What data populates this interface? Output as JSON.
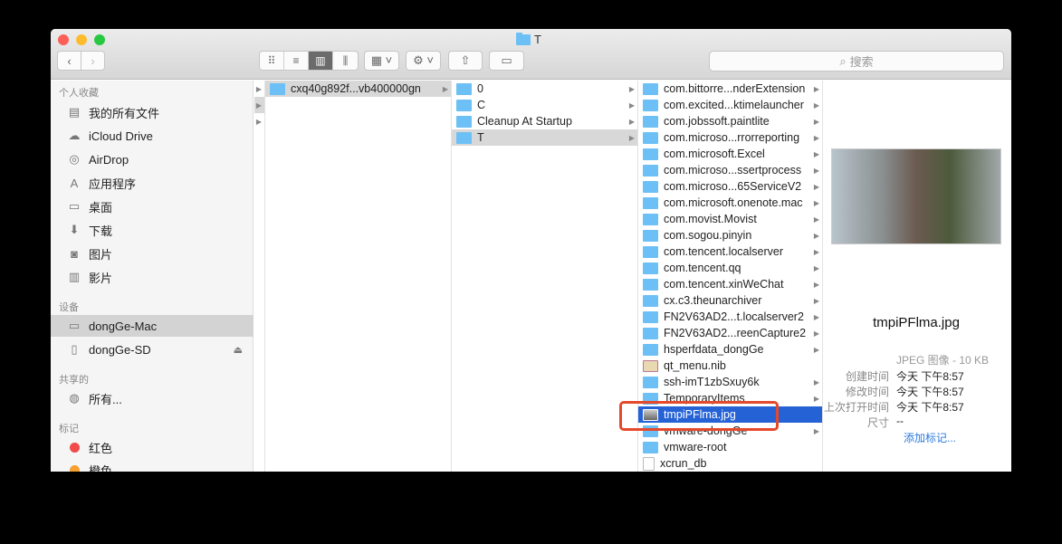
{
  "window": {
    "title": "T"
  },
  "toolbar": {
    "back": "‹",
    "forward": "›",
    "views": [
      "icon-view",
      "list-view",
      "column-view",
      "cover-flow-view"
    ],
    "search_placeholder": "搜索"
  },
  "sidebar": {
    "favorites_header": "个人收藏",
    "favorites": [
      {
        "label": "我的所有文件",
        "icon": "all-files-icon"
      },
      {
        "label": "iCloud Drive",
        "icon": "cloud-icon"
      },
      {
        "label": "AirDrop",
        "icon": "airdrop-icon"
      },
      {
        "label": "应用程序",
        "icon": "applications-icon"
      },
      {
        "label": "桌面",
        "icon": "desktop-icon"
      },
      {
        "label": "下载",
        "icon": "download-icon"
      },
      {
        "label": "图片",
        "icon": "camera-icon"
      },
      {
        "label": "影片",
        "icon": "film-icon"
      }
    ],
    "devices_header": "设备",
    "devices": [
      {
        "label": "dongGe-Mac",
        "selected": true
      },
      {
        "label": "dongGe-SD",
        "eject": "⏏"
      }
    ],
    "shared_header": "共享的",
    "shared": [
      {
        "label": "所有..."
      }
    ],
    "tags_header": "标记",
    "tags": [
      {
        "label": "红色",
        "color": "#f04a4a"
      },
      {
        "label": "橙色",
        "color": "#f5a030"
      }
    ]
  },
  "columns": {
    "col1": [
      {
        "name": "cxq40g892f...vb400000gn",
        "folder": true
      }
    ],
    "col2": [
      {
        "name": "0"
      },
      {
        "name": "C"
      },
      {
        "name": "Cleanup At Startup"
      },
      {
        "name": "T",
        "selected": true
      }
    ],
    "col3": [
      {
        "name": "com.bittorre...nderExtension",
        "type": "folder"
      },
      {
        "name": "com.excited...ktimelauncher",
        "type": "folder"
      },
      {
        "name": "com.jobssoft.paintlite",
        "type": "folder"
      },
      {
        "name": "com.microso...rrorreporting",
        "type": "folder"
      },
      {
        "name": "com.microsoft.Excel",
        "type": "folder"
      },
      {
        "name": "com.microso...ssertprocess",
        "type": "folder"
      },
      {
        "name": "com.microso...65ServiceV2",
        "type": "folder"
      },
      {
        "name": "com.microsoft.onenote.mac",
        "type": "folder"
      },
      {
        "name": "com.movist.Movist",
        "type": "folder"
      },
      {
        "name": "com.sogou.pinyin",
        "type": "folder"
      },
      {
        "name": "com.tencent.localserver",
        "type": "folder"
      },
      {
        "name": "com.tencent.qq",
        "type": "folder"
      },
      {
        "name": "com.tencent.xinWeChat",
        "type": "folder"
      },
      {
        "name": "cx.c3.theunarchiver",
        "type": "folder"
      },
      {
        "name": "FN2V63AD2...t.localserver2",
        "type": "folder"
      },
      {
        "name": "FN2V63AD2...reenCapture2",
        "type": "folder"
      },
      {
        "name": "hsperfdata_dongGe",
        "type": "folder"
      },
      {
        "name": "qt_menu.nib",
        "type": "nib"
      },
      {
        "name": "ssh-imT1zbSxuy6k",
        "type": "folder"
      },
      {
        "name": "TemporaryItems",
        "type": "folder"
      },
      {
        "name": "tmpiPFlma.jpg",
        "type": "img",
        "selected": true
      },
      {
        "name": "vmware-dongGe",
        "type": "folder"
      },
      {
        "name": "vmware-root",
        "type": "folder"
      },
      {
        "name": "xcrun_db",
        "type": "doc"
      }
    ]
  },
  "preview": {
    "filename": "tmpiPFlma.jpg",
    "kind": "JPEG 图像 - 10 KB",
    "rows": [
      {
        "k": "创建时间",
        "v": "今天 下午8:57"
      },
      {
        "k": "修改时间",
        "v": "今天 下午8:57"
      },
      {
        "k": "上次打开时间",
        "v": "今天 下午8:57"
      },
      {
        "k": "尺寸",
        "v": "--"
      }
    ],
    "add_tags": "添加标记..."
  },
  "colors": {
    "selection": "#2462d6",
    "highlight_box": "#e5492b",
    "folder": "#6cc0f5"
  }
}
